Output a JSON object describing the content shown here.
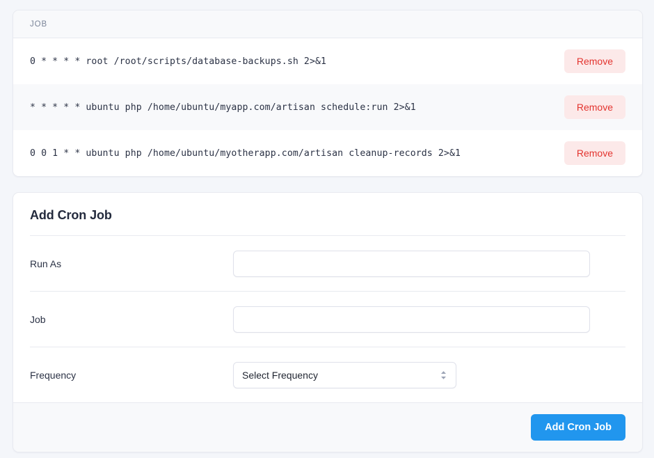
{
  "jobs_card": {
    "header_label": "JOB",
    "rows": [
      {
        "command": "0 * * * * root /root/scripts/database-backups.sh 2>&1",
        "remove_label": "Remove"
      },
      {
        "command": "* * * * * ubuntu php /home/ubuntu/myapp.com/artisan schedule:run 2>&1",
        "remove_label": "Remove"
      },
      {
        "command": "0 0 1 * * ubuntu php /home/ubuntu/myotherapp.com/artisan cleanup-records 2>&1",
        "remove_label": "Remove"
      }
    ]
  },
  "add_card": {
    "title": "Add Cron Job",
    "fields": {
      "run_as": {
        "label": "Run As",
        "value": "",
        "placeholder": ""
      },
      "job": {
        "label": "Job",
        "value": "",
        "placeholder": ""
      },
      "frequency": {
        "label": "Frequency",
        "selected": "Select Frequency"
      }
    },
    "submit_label": "Add Cron Job"
  },
  "colors": {
    "page_background": "#f4f6fa",
    "primary": "#2196ee",
    "danger_text": "#e3342f",
    "danger_background": "#fce9e9",
    "muted_text": "#7b8599"
  }
}
